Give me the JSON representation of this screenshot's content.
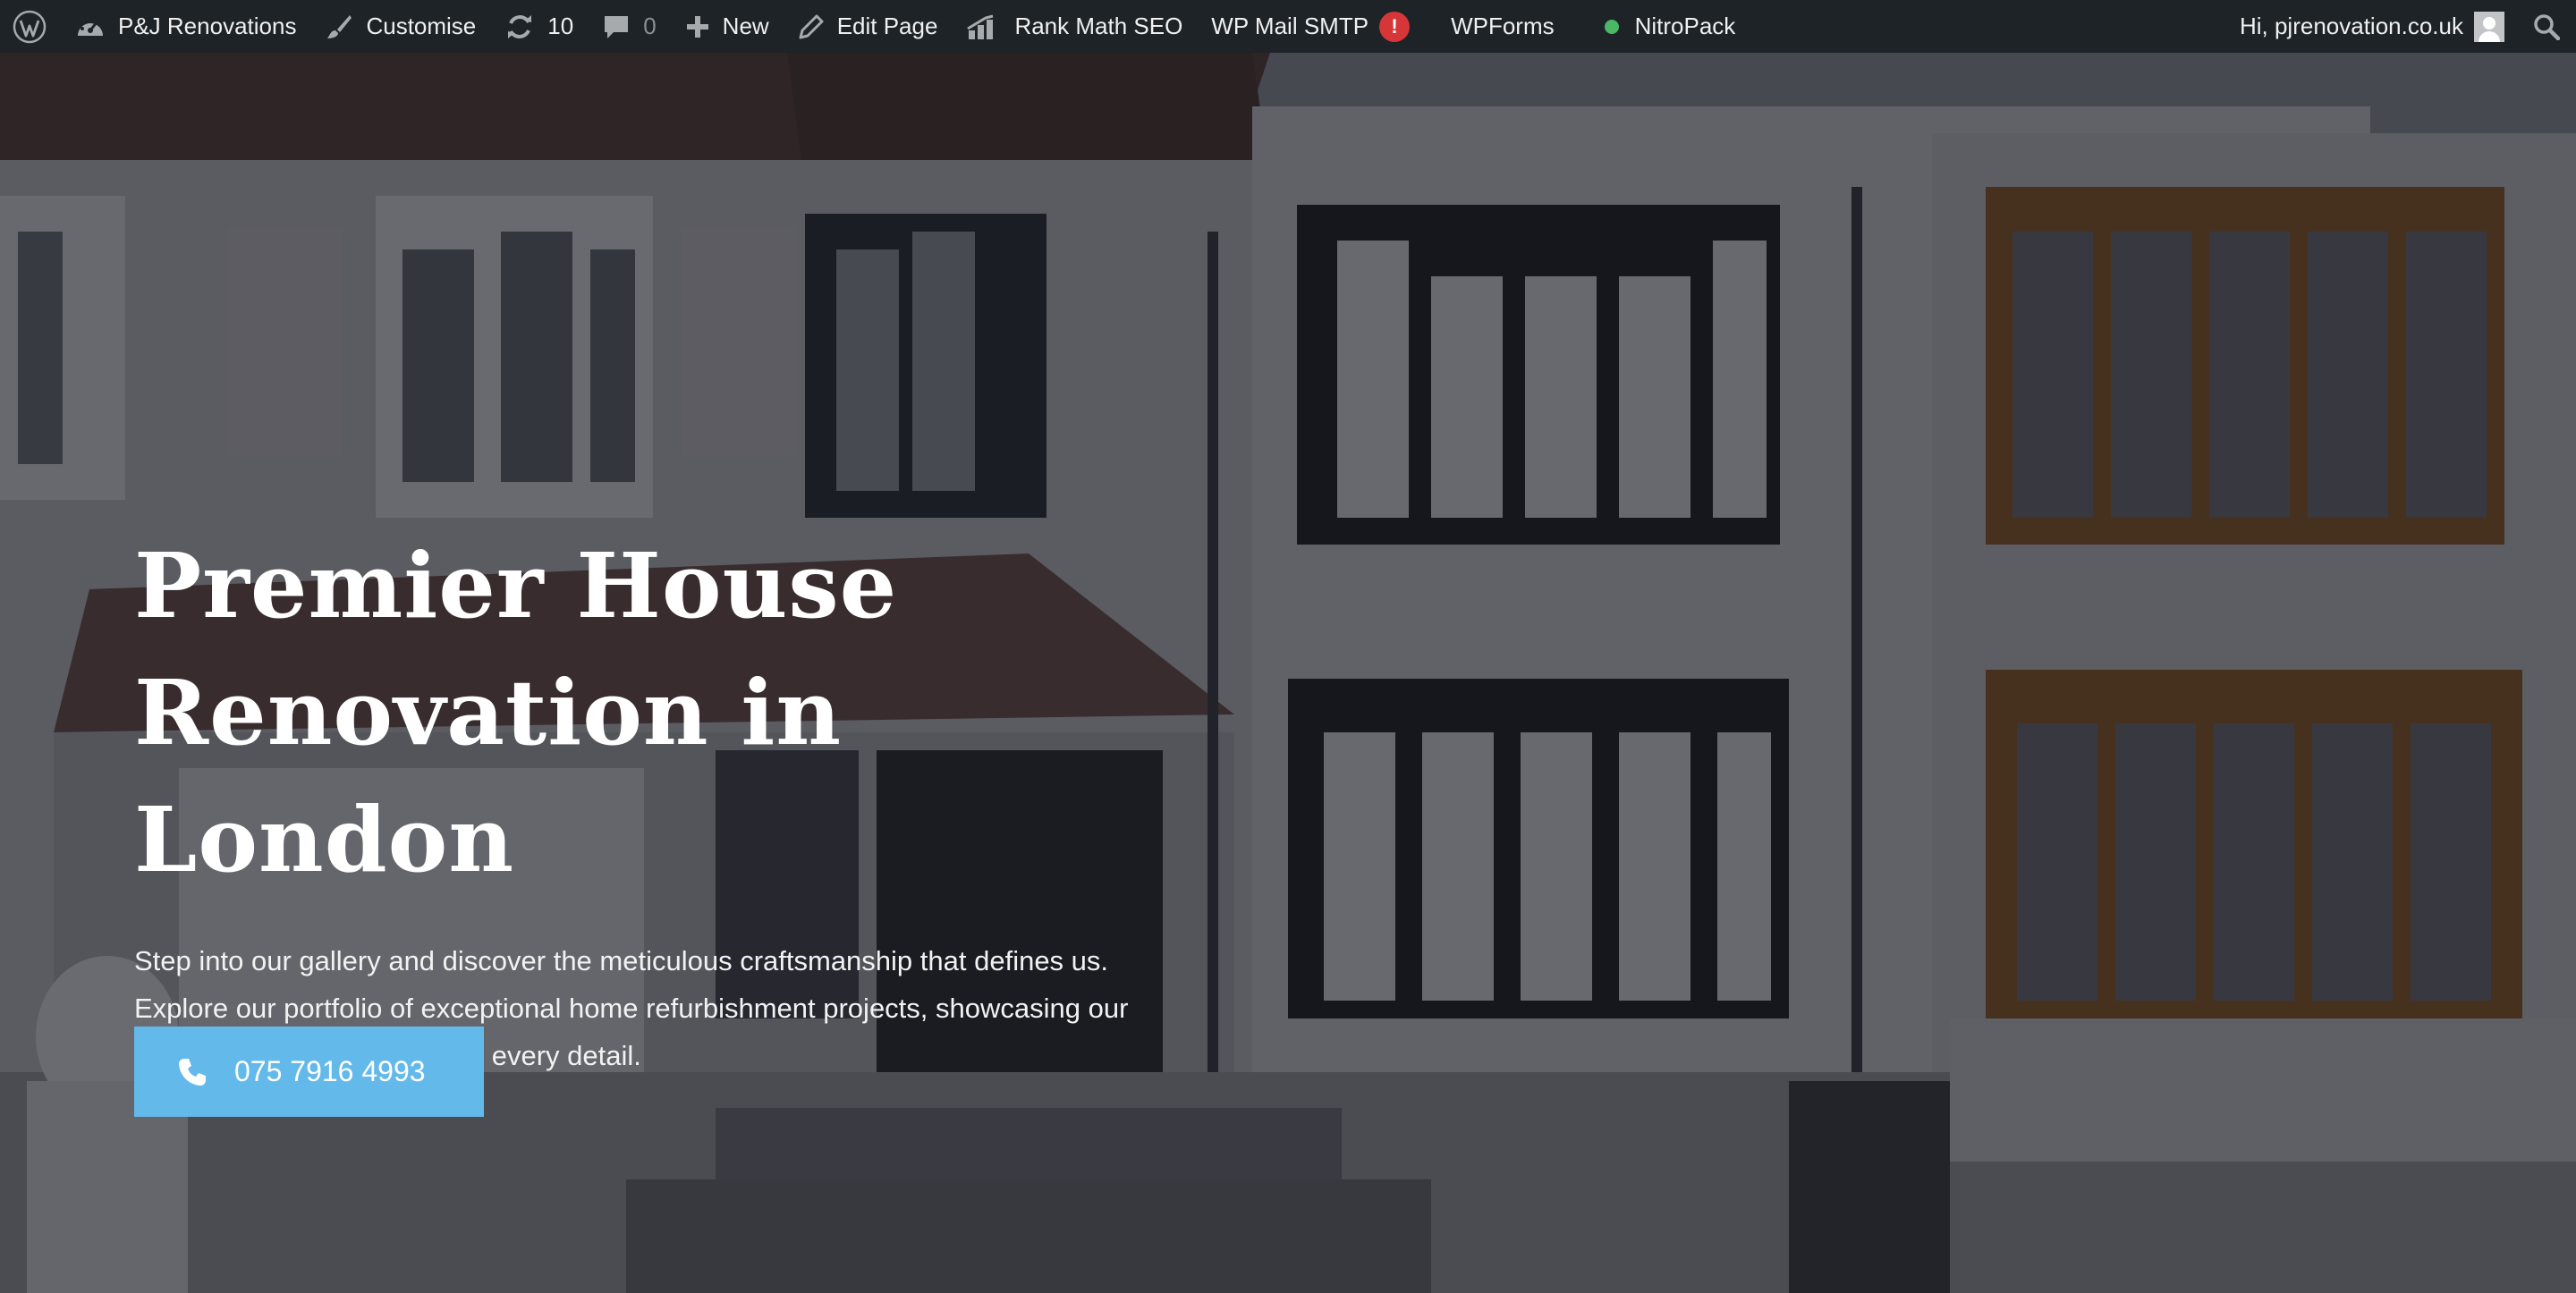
{
  "admin_bar": {
    "site_name": "P&J Renovations",
    "customise": "Customise",
    "updates_count": "10",
    "comments_count": "0",
    "new_label": "New",
    "edit_page": "Edit Page",
    "rank_math": "Rank Math SEO",
    "wp_mail_smtp": "WP Mail SMTP",
    "smtp_badge": "!",
    "wpforms": "WPForms",
    "nitropack": "NitroPack",
    "nitropack_status_color": "#4ab866",
    "greeting": "Hi, pjrenovation.co.uk"
  },
  "hero": {
    "title": "Premier House Renovation in London",
    "text": "Step into our gallery and discover the meticulous craftsmanship that defines us. Explore our portfolio of exceptional home refurbishment projects, showcasing our commitment to excellence in every detail.",
    "cta_phone": "075 7916 4993",
    "cta_color": "#64b9eb"
  }
}
